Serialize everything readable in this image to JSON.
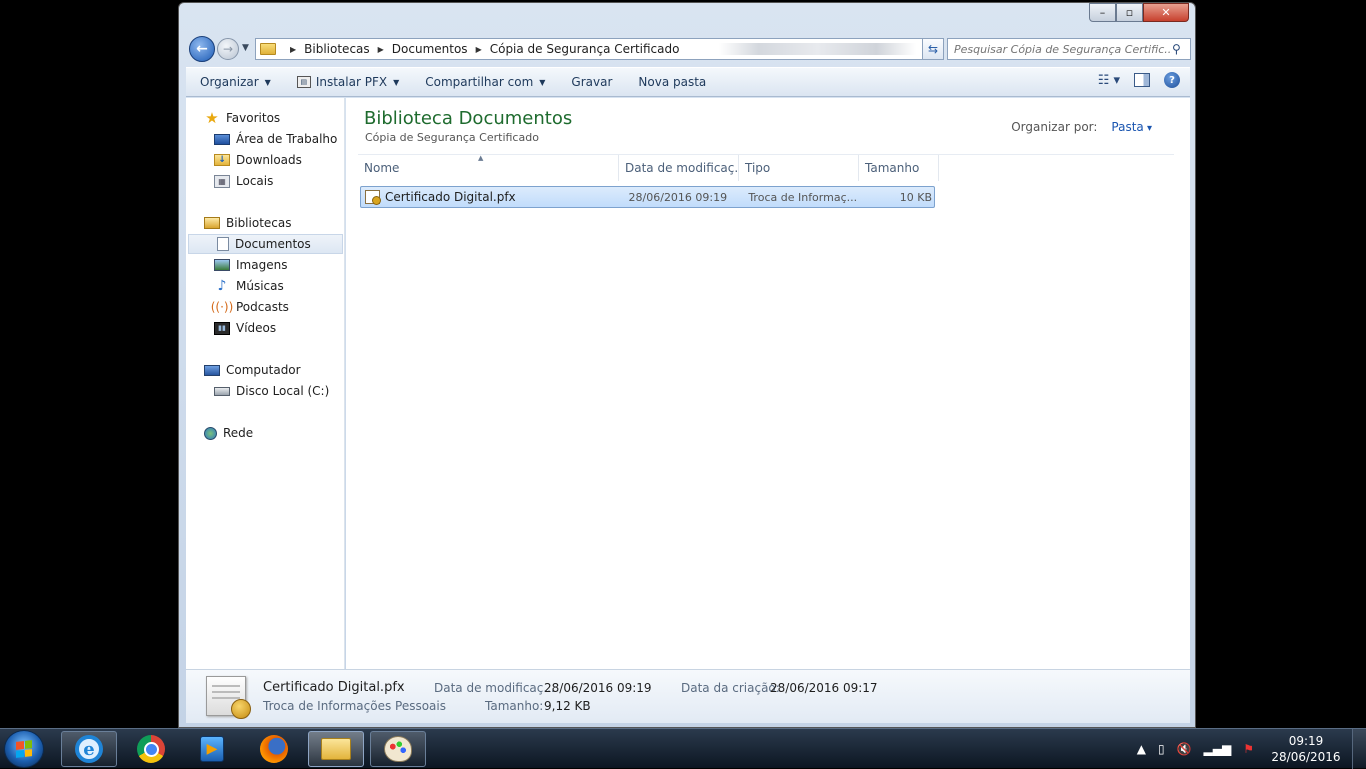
{
  "window": {
    "controls": {
      "minimize": "–",
      "maximize": "▫",
      "close": "✕"
    }
  },
  "address": {
    "breadcrumbs": [
      "Bibliotecas",
      "Documentos",
      "Cópia de Segurança Certificado"
    ],
    "search_placeholder": "Pesquisar Cópia de Segurança Certific..."
  },
  "toolbar": {
    "organize": "Organizar",
    "install_pfx": "Instalar PFX",
    "share": "Compartilhar com",
    "burn": "Gravar",
    "new_folder": "Nova pasta"
  },
  "nav": {
    "favorites": "Favoritos",
    "desktop": "Área de Trabalho",
    "downloads": "Downloads",
    "recent": "Locais",
    "libraries": "Bibliotecas",
    "documents": "Documentos",
    "images": "Imagens",
    "music": "Músicas",
    "podcasts": "Podcasts",
    "videos": "Vídeos",
    "computer": "Computador",
    "local_disk": "Disco Local (C:)",
    "network": "Rede"
  },
  "main": {
    "title": "Biblioteca Documentos",
    "subtitle": "Cópia de Segurança Certificado",
    "arrange_label": "Organizar por:",
    "arrange_value": "Pasta",
    "columns": {
      "name": "Nome",
      "date": "Data de modificaç...",
      "type": "Tipo",
      "size": "Tamanho"
    },
    "files": [
      {
        "name": "Certificado Digital.pfx",
        "date": "28/06/2016 09:19",
        "type": "Troca de Informaç...",
        "size": "10 KB"
      }
    ]
  },
  "details": {
    "name": "Certificado Digital.pfx",
    "type": "Troca de Informações Pessoais",
    "modified_label": "Data de modificaç...",
    "modified_value": "28/06/2016 09:19",
    "size_label": "Tamanho:",
    "size_value": "9,12 KB",
    "created_label": "Data da criação:",
    "created_value": "28/06/2016 09:17"
  },
  "taskbar": {
    "time": "09:19",
    "date": "28/06/2016"
  },
  "colors": {
    "title_green": "#1e6b2e",
    "accent_blue": "#1a55b0",
    "selection": "#c1dcfb"
  }
}
